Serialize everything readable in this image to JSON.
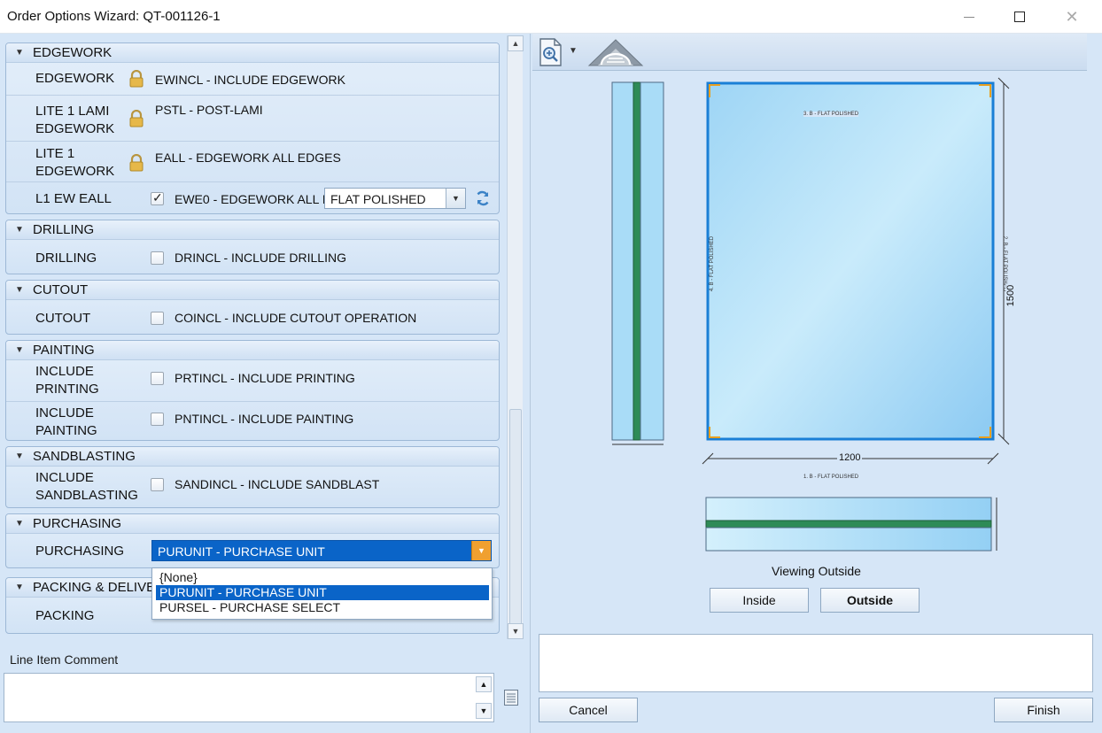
{
  "window": {
    "title": "Order Options Wizard: QT-001126-1"
  },
  "sections": {
    "edgework": {
      "title": "EDGEWORK",
      "rows": [
        {
          "label": "EDGEWORK",
          "value": "EWINCL - INCLUDE EDGEWORK"
        },
        {
          "label": "LITE 1 LAMI EDGEWORK",
          "label_l1": "LITE 1 LAMI",
          "label_l2": "EDGEWORK",
          "value": "PSTL - POST-LAMI"
        },
        {
          "label": "LITE 1 EDGEWORK",
          "label_l1": "LITE 1",
          "label_l2": "EDGEWORK",
          "value": "EALL - EDGEWORK ALL EDGES"
        },
        {
          "label": "L1 EW EALL",
          "value": "EWE0 - EDGEWORK ALL I",
          "checked": true,
          "select_value": "FLAT POLISHED"
        }
      ]
    },
    "drilling": {
      "title": "DRILLING",
      "rows": [
        {
          "label": "DRILLING",
          "value": "DRINCL - INCLUDE DRILLING",
          "checked": false
        }
      ]
    },
    "cutout": {
      "title": "CUTOUT",
      "rows": [
        {
          "label": "CUTOUT",
          "value": "COINCL - INCLUDE CUTOUT OPERATION",
          "checked": false
        }
      ]
    },
    "painting": {
      "title": "PAINTING",
      "rows": [
        {
          "label_l1": "INCLUDE",
          "label_l2": "PRINTING",
          "value": "PRTINCL - INCLUDE PRINTING",
          "checked": false
        },
        {
          "label_l1": "INCLUDE",
          "label_l2": "PAINTING",
          "value": "PNTINCL - INCLUDE PAINTING",
          "checked": false
        }
      ]
    },
    "sandblasting": {
      "title": "SANDBLASTING",
      "rows": [
        {
          "label_l1": "INCLUDE",
          "label_l2": "SANDBLASTING",
          "value": "SANDINCL - INCLUDE SANDBLAST",
          "checked": false
        }
      ]
    },
    "purchasing": {
      "title": "PURCHASING",
      "rows": [
        {
          "label": "PURCHASING",
          "select_value": "PURUNIT - PURCHASE UNIT"
        }
      ]
    },
    "packing": {
      "title": "PACKING & DELIVER",
      "rows": [
        {
          "label": "PACKING"
        }
      ]
    }
  },
  "dropdown_options": [
    "{None}",
    "PURUNIT - PURCHASE UNIT",
    "PURSEL - PURCHASE SELECT"
  ],
  "comment": {
    "label": "Line Item Comment",
    "value": ""
  },
  "drawing": {
    "top_edge": "3. B - FLAT POLISHED",
    "bottom_edge": "1. B - FLAT POLISHED",
    "left_edge": "4. B - FLAT POLISHED",
    "right_edge": "2. B - FLAT POLISHED",
    "width": "1200",
    "height": "1500",
    "viewing_label": "Viewing Outside",
    "colors": {
      "glass": "#a9dcf7",
      "frame": "#1a7fd6",
      "interlayer": "#2e8b57",
      "corner": "#e8a020"
    }
  },
  "buttons": {
    "inside": "Inside",
    "outside": "Outside",
    "cancel": "Cancel",
    "finish": "Finish"
  },
  "icons": [
    "lock-icon",
    "refresh-icon",
    "zoom-icon",
    "dropdown-caret-icon",
    "shape-icon",
    "note-icon"
  ]
}
